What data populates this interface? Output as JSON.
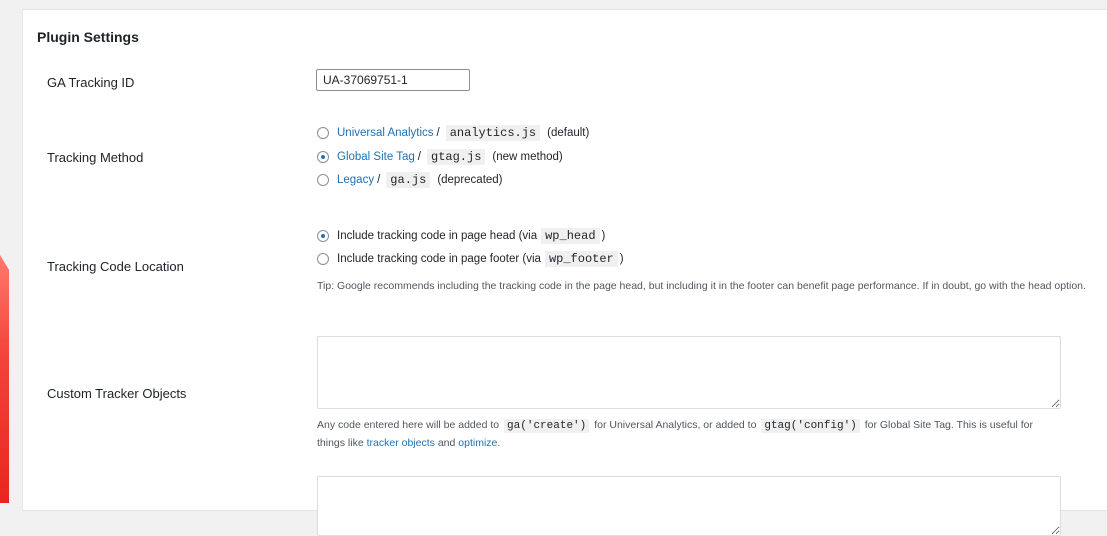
{
  "panel": {
    "title": "Plugin Settings"
  },
  "fields": {
    "tracking_id": {
      "label": "GA Tracking ID",
      "value": "UA-37069751-1"
    },
    "tracking_method": {
      "label": "Tracking Method",
      "options": [
        {
          "link": "Universal Analytics",
          "code": "analytics.js",
          "note": "(default)",
          "checked": false
        },
        {
          "link": "Global Site Tag",
          "code": "gtag.js",
          "note": "(new method)",
          "checked": true
        },
        {
          "link": "Legacy",
          "code": "ga.js",
          "note": "(deprecated)",
          "checked": false
        }
      ]
    },
    "code_location": {
      "label": "Tracking Code Location",
      "options": [
        {
          "text": "Include tracking code in page head (via",
          "code": "wp_head",
          "close": ")",
          "checked": true
        },
        {
          "text": "Include tracking code in page footer (via",
          "code": "wp_footer",
          "close": ")",
          "checked": false
        }
      ],
      "tip": "Tip: Google recommends including the tracking code in the page head, but including it in the footer can benefit page performance. If in doubt, go with the head option."
    },
    "custom_tracker": {
      "label": "Custom Tracker Objects",
      "value": "",
      "desc": {
        "part1": "Any code entered here will be added to",
        "code1": "ga('create')",
        "part2": "for Universal Analytics, or added to",
        "code2": "gtag('config')",
        "part3": "for Global Site Tag. This is useful for things like",
        "link1": "tracker objects",
        "part4": "and",
        "link2": "optimize",
        "part5": "."
      }
    }
  },
  "colors": {
    "accent": "#2271b1",
    "side_bar": "#e8261f"
  }
}
